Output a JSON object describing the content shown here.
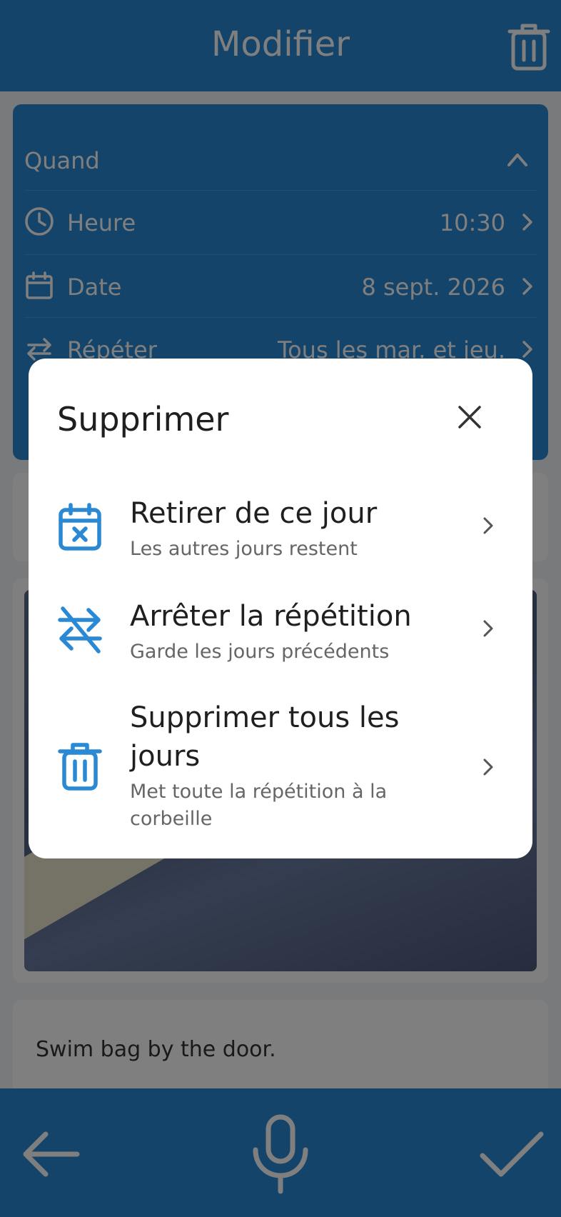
{
  "header": {
    "title": "Modifier",
    "delete_icon": "trash-icon"
  },
  "when_section": {
    "heading": "Quand",
    "rows": [
      {
        "label": "Heure",
        "value": "10:30",
        "icon": "clock-icon"
      },
      {
        "label": "Date",
        "value": "8 sept. 2026",
        "icon": "calendar-icon"
      },
      {
        "label": "Répéter",
        "value": "Tous les mar. et jeu.",
        "icon": "repeat-icon"
      }
    ]
  },
  "note": {
    "text": "Swim bag by the door."
  },
  "bottom_bar": {
    "back_icon": "arrow-left-icon",
    "mic_icon": "microphone-icon",
    "confirm_icon": "check-icon"
  },
  "dialog": {
    "title": "Supprimer",
    "options": [
      {
        "title": "Retirer de ce jour",
        "subtitle": "Les autres jours restent",
        "icon": "calendar-x-icon"
      },
      {
        "title": "Arrêter la répétition",
        "subtitle": "Garde les jours précédents",
        "icon": "repeat-off-icon"
      },
      {
        "title": "Supprimer tous les jours",
        "subtitle": "Met toute la répétition à la corbeille",
        "icon": "trash-icon"
      }
    ]
  },
  "colors": {
    "primary": "#2a89d4",
    "icon_blue": "#2a89d4",
    "scrim": "rgba(0,0,0,0.5)"
  }
}
